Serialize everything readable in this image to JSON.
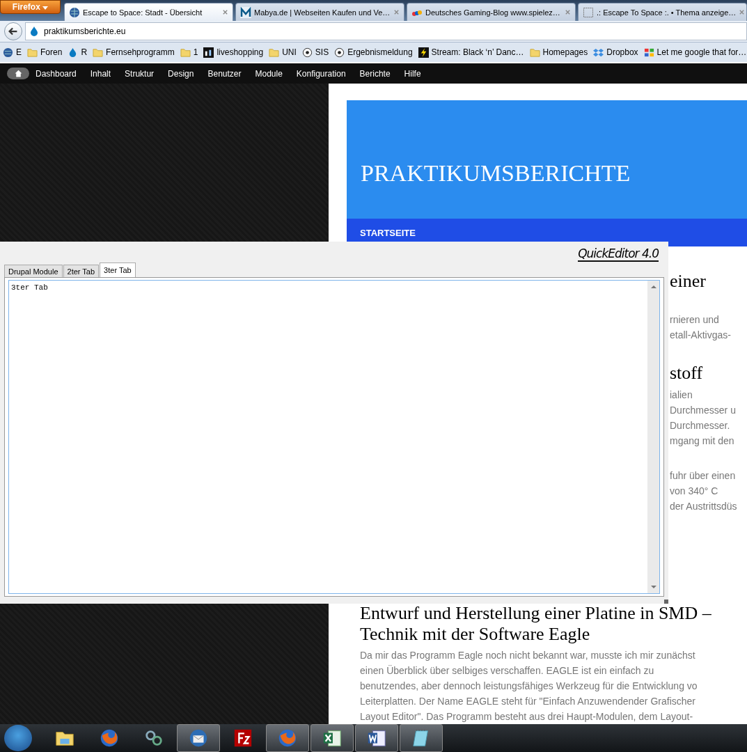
{
  "browser": {
    "menu_button": "Firefox",
    "tabs": [
      {
        "title": "Escape to Space: Stadt - Übersicht",
        "selected": true
      },
      {
        "title": "Mabya.de | Webseiten Kaufen und Ve…",
        "selected": false
      },
      {
        "title": "Deutsches Gaming-Blog www.spielez…",
        "selected": false
      },
      {
        "title": ".: Escape To Space :. • Thema anzeige…",
        "selected": false
      }
    ],
    "address": "praktikumsberichte.eu",
    "bookmarks": [
      {
        "label": "E",
        "kind": "site"
      },
      {
        "label": "Foren",
        "kind": "folder"
      },
      {
        "label": "R",
        "kind": "site"
      },
      {
        "label": "Fernsehprogramm",
        "kind": "folder"
      },
      {
        "label": "1",
        "kind": "folder"
      },
      {
        "label": "liveshopping",
        "kind": "site"
      },
      {
        "label": "UNI",
        "kind": "folder"
      },
      {
        "label": "SIS",
        "kind": "site"
      },
      {
        "label": "Ergebnismeldung",
        "kind": "site"
      },
      {
        "label": "Stream: Black ‘n’ Danc…",
        "kind": "site"
      },
      {
        "label": "Homepages",
        "kind": "folder"
      },
      {
        "label": "Dropbox",
        "kind": "site"
      },
      {
        "label": "Let me google that for…",
        "kind": "site"
      }
    ]
  },
  "admin_toolbar": {
    "items": [
      "Dashboard",
      "Inhalt",
      "Struktur",
      "Design",
      "Benutzer",
      "Module",
      "Konfiguration",
      "Berichte",
      "Hilfe"
    ]
  },
  "site": {
    "title": "PRAKTIKUMSBERICHTE",
    "nav": [
      {
        "label": "STARTSEITE"
      }
    ],
    "hidden_fragments": [
      {
        "kind": "heading",
        "text": "einer"
      },
      {
        "kind": "gap"
      },
      {
        "kind": "line",
        "text": "rnieren und"
      },
      {
        "kind": "line",
        "text": "etall-Aktivgas-"
      },
      {
        "kind": "gap"
      },
      {
        "kind": "heading",
        "text": "stoff"
      },
      {
        "kind": "line",
        "text": "ialien"
      },
      {
        "kind": "line",
        "text": "Durchmesser u"
      },
      {
        "kind": "line",
        "text": "Durchmesser."
      },
      {
        "kind": "line",
        "text": "mgang mit den"
      },
      {
        "kind": "gap"
      },
      {
        "kind": "line",
        "text": "fuhr über einen"
      },
      {
        "kind": "line",
        "text": "von 340° C"
      },
      {
        "kind": "line",
        "text": "der Austrittsdüs"
      }
    ],
    "article": {
      "heading_lines": [
        "Entwurf und Herstellung einer Platine in SMD –",
        "Technik mit der Software Eagle"
      ],
      "lines": [
        "Da mir das Programm Eagle noch nicht bekannt war, musste ich mir zunächst",
        "einen Überblick über selbiges verschaffen. EAGLE ist ein einfach zu",
        "benutzendes, aber dennoch leistungsfähiges Werkzeug für die Entwicklung vo",
        "Leiterplatten. Der Name EAGLE steht für \"Einfach Anzuwendender Grafischer",
        "Layout Editor\". Das Programm besteht aus drei Haupt-Modulen, dem Layout-"
      ]
    }
  },
  "editor": {
    "brand": "QuickEditor 4.0",
    "tabs": [
      {
        "label": "Drupal Module",
        "selected": false
      },
      {
        "label": "2ter Tab",
        "selected": false
      },
      {
        "label": "3ter Tab",
        "selected": true
      }
    ],
    "content": "3ter Tab"
  },
  "taskbar": {
    "apps": [
      {
        "kind": "folder",
        "running": false
      },
      {
        "kind": "firefox",
        "running": false
      },
      {
        "kind": "network",
        "running": false
      },
      {
        "kind": "mail",
        "running": true
      },
      {
        "kind": "ftp",
        "running": false
      },
      {
        "kind": "firefox",
        "running": true
      },
      {
        "kind": "excel",
        "running": true
      },
      {
        "kind": "word",
        "running": true
      },
      {
        "kind": "notepad",
        "running": true
      }
    ]
  }
}
